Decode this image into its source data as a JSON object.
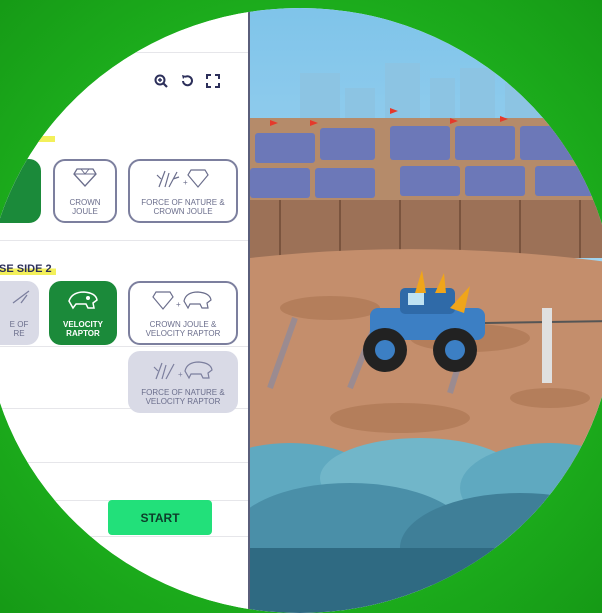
{
  "toolbar": {
    "zoom_icon": "magnify-plus-icon",
    "reset_icon": "rotate-ccw-icon",
    "fullscreen_icon": "fullscreen-icon"
  },
  "side2_label": "SE SIDE 2",
  "cards": {
    "crown_joule": "CROWN JOULE",
    "force_crown": "FORCE OF NATURE & CROWN JOULE",
    "force_partial": "E OF RE",
    "velocity_raptor": "VELOCITY RAPTOR",
    "crown_velocity": "CROWN JOULE & VELOCITY RAPTOR",
    "force_velocity": "FORCE OF NATURE & VELOCITY RAPTOR"
  },
  "start_label": "START",
  "colors": {
    "background_green": "#1fb51f",
    "selected_green": "#1b8a3a",
    "start_green": "#22e07a",
    "label_highlight": "#f3f05a"
  }
}
